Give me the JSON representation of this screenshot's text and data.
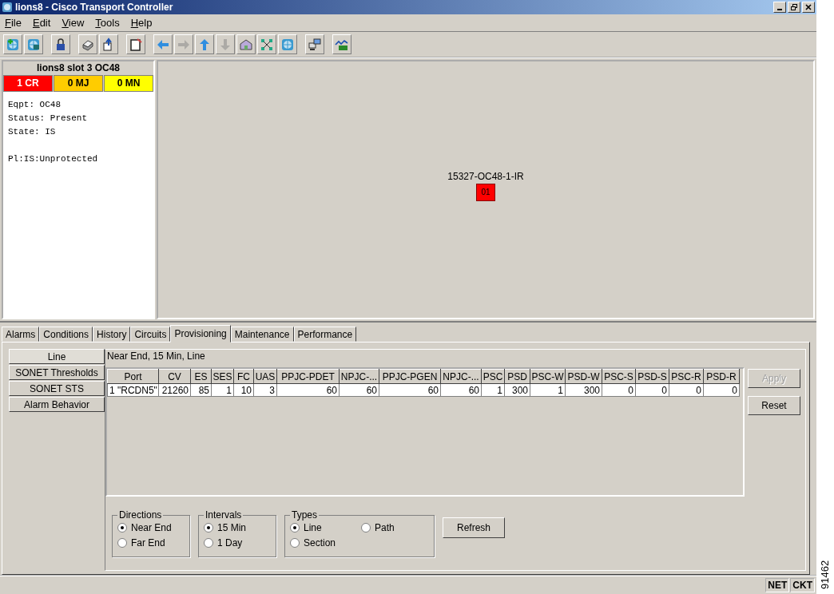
{
  "window": {
    "title": "lions8 - Cisco Transport Controller"
  },
  "menu": [
    "File",
    "Edit",
    "View",
    "Tools",
    "Help"
  ],
  "toolbar": [
    {
      "kind": "globe-plus",
      "disabled": false
    },
    {
      "kind": "globe-card",
      "disabled": false
    },
    {
      "kind": "lock",
      "disabled": false
    },
    {
      "kind": "printer",
      "disabled": false
    },
    {
      "kind": "export",
      "disabled": false
    },
    {
      "kind": "notepad",
      "disabled": false
    },
    {
      "kind": "arrow-left",
      "disabled": false
    },
    {
      "kind": "arrow-right",
      "disabled": true
    },
    {
      "kind": "arrow-up",
      "disabled": false
    },
    {
      "kind": "arrow-down",
      "disabled": true
    },
    {
      "kind": "house",
      "disabled": false
    },
    {
      "kind": "network",
      "disabled": false
    },
    {
      "kind": "globe",
      "disabled": false
    },
    {
      "kind": "computers",
      "disabled": false
    },
    {
      "kind": "chart",
      "disabled": false
    }
  ],
  "card_view": {
    "title": "lions8 slot 3 OC48",
    "alarms": [
      {
        "label": "1 CR",
        "color": "#ff0000"
      },
      {
        "label": "0 MJ",
        "color": "#ffcc00"
      },
      {
        "label": "0 MN",
        "color": "#ffff00"
      }
    ],
    "info_blocks": [
      [
        "Eqpt: OC48",
        "Status: Present",
        "State: IS"
      ],
      [
        "Pl:IS:Unprotected"
      ]
    ]
  },
  "shelf": {
    "card_label": "15327-OC48-1-IR",
    "port": "01",
    "color": "#ff0000"
  },
  "tabs": [
    {
      "label": "Alarms",
      "selected": false
    },
    {
      "label": "Conditions",
      "selected": false
    },
    {
      "label": "History",
      "selected": false
    },
    {
      "label": "Circuits",
      "selected": false
    },
    {
      "label": "Provisioning",
      "selected": true
    },
    {
      "label": "Maintenance",
      "selected": false
    },
    {
      "label": "Performance",
      "selected": false
    }
  ],
  "subtabs": [
    {
      "label": "Line",
      "selected": true
    },
    {
      "label": "SONET Thresholds",
      "selected": false
    },
    {
      "label": "SONET STS",
      "selected": false
    },
    {
      "label": "Alarm Behavior",
      "selected": false
    }
  ],
  "caption": "Near End, 15 Min, Line",
  "table": {
    "columns": [
      "Port",
      "CV",
      "ES",
      "SES",
      "FC",
      "UAS",
      "PPJC-PDET",
      "NPJC-...",
      "PPJC-PGEN",
      "NPJC-...",
      "PSC",
      "PSD",
      "PSC-W",
      "PSD-W",
      "PSC-S",
      "PSD-S",
      "PSC-R",
      "PSD-R"
    ],
    "rows": [
      [
        "1 \"RCDN5\"",
        "21260",
        "85",
        "1",
        "10",
        "3",
        "60",
        "60",
        "60",
        "60",
        "1",
        "300",
        "1",
        "300",
        "0",
        "0",
        "0",
        "0"
      ]
    ]
  },
  "side_buttons": [
    {
      "label": "Apply",
      "disabled": true
    },
    {
      "label": "Reset",
      "disabled": false
    }
  ],
  "radio_groups": [
    {
      "title": "Directions",
      "options": [
        {
          "label": "Near End",
          "selected": true
        },
        {
          "label": "Far End",
          "selected": false
        }
      ]
    },
    {
      "title": "Intervals",
      "options": [
        {
          "label": "15 Min",
          "selected": true
        },
        {
          "label": "1 Day",
          "selected": false
        }
      ]
    },
    {
      "title": "Types",
      "options": [
        {
          "label": "Line",
          "selected": true
        },
        {
          "label": "Path",
          "selected": false
        },
        {
          "label": "Section",
          "selected": false
        }
      ]
    }
  ],
  "refresh_button": "Refresh",
  "status_bar": [
    "NET",
    "CKT"
  ],
  "figure_number": "91462"
}
